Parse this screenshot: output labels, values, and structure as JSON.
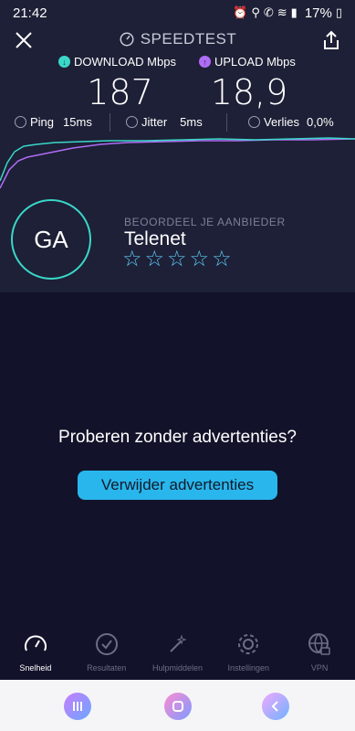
{
  "status_bar": {
    "time": "21:42",
    "battery": "17%"
  },
  "header": {
    "title": "SPEEDTEST"
  },
  "metrics": {
    "download": {
      "label": "DOWNLOAD Mbps",
      "value": "187",
      "color": "#3ad7c9"
    },
    "upload": {
      "label": "UPLOAD Mbps",
      "value": "18,9",
      "color": "#b06cf5"
    }
  },
  "stats": {
    "ping": {
      "label": "Ping",
      "value": "15ms"
    },
    "jitter": {
      "label": "Jitter",
      "value": "5ms"
    },
    "loss": {
      "label": "Verlies",
      "value": "0,0%"
    }
  },
  "isp": {
    "initials": "GA",
    "rate_label": "BEOORDEEL JE AANBIEDER",
    "name": "Telenet",
    "stars": 5
  },
  "promo": {
    "text": "Proberen zonder advertenties?",
    "button": "Verwijder advertenties"
  },
  "tabs": [
    {
      "label": "Snelheid",
      "icon": "speedometer-icon",
      "active": true
    },
    {
      "label": "Resultaten",
      "icon": "check-circle-icon",
      "active": false
    },
    {
      "label": "Hulpmiddelen",
      "icon": "magic-wand-icon",
      "active": false
    },
    {
      "label": "Instellingen",
      "icon": "gear-icon",
      "active": false
    },
    {
      "label": "VPN",
      "icon": "globe-lock-icon",
      "active": false
    }
  ],
  "colors": {
    "accent_cyan": "#3ad7c9",
    "accent_purple": "#b06cf5",
    "button_blue": "#29b6ec"
  }
}
